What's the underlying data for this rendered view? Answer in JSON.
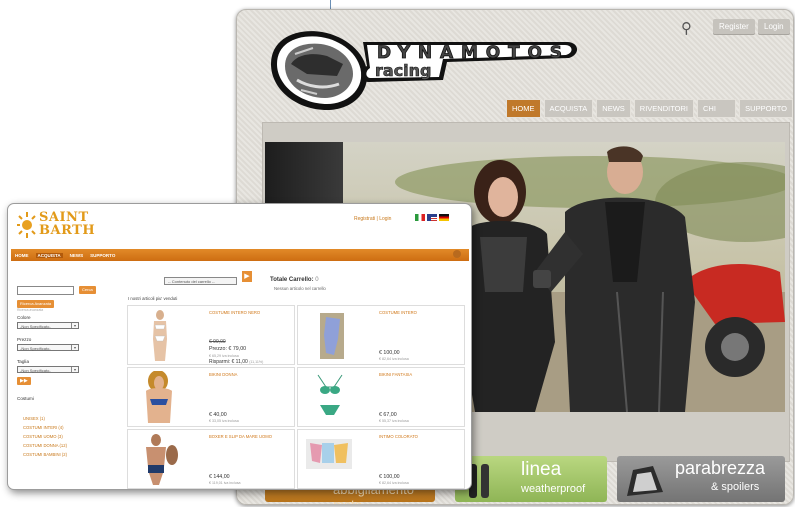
{
  "dynamotos": {
    "logo_top": "DYNAMOTOS",
    "logo_bottom": "racing",
    "buttons": {
      "register": "Register",
      "login": "Login"
    },
    "nav": [
      "HOME",
      "ACQUISTA",
      "NEWS",
      "RIVENDITORI",
      "CHI SIAMO",
      "SUPPORTO"
    ],
    "banners": {
      "left": "abbigliamento moto",
      "middle_title": "linea",
      "middle_sub": "weatherproof",
      "right_title": "parabrezza",
      "right_sub": "& spoilers"
    },
    "colors": {
      "accent": "#c0792b",
      "nav_inactive": "#c9c6c0"
    }
  },
  "saintbarth": {
    "logo_line1": "SAINT",
    "logo_line2": "BARTH",
    "top_links": {
      "register": "Registrati",
      "separator": "|",
      "login": "Login"
    },
    "nav": [
      "HOME",
      "ACQUISTA",
      "NEWS",
      "SUPPORTO"
    ],
    "search": {
      "button": "Cerca",
      "advanced": "Ricerca Avanzata",
      "advanced_sub": "Ricerca avanzata"
    },
    "filters": [
      {
        "label": "Colore",
        "value": "-Non Specificato-"
      },
      {
        "label": "Prezzo",
        "value": "-Non Specificato-"
      },
      {
        "label": "Taglia",
        "value": "-Non Specificato-"
      }
    ],
    "go": "▶▶",
    "categories_title": "Costumi",
    "categories": [
      "UNISEX (1)",
      "COSTUMI INTERI (4)",
      "COSTUMI UOMO (3)",
      "COSTUMI DONNA (12)",
      "COSTUMI BAMBINI (2)"
    ],
    "cart": {
      "select": "-- Contenuto del carrello --",
      "title": "Totale Carrello:",
      "count": "0",
      "message": "Nessun articolo nel carrello",
      "go": "▶"
    },
    "grid_title": "I nostri articoli piu' venduti",
    "products": [
      {
        "name": "COSTUME INTERO NERO",
        "old": "€ 99,00",
        "price": "Prezzo: € 79,00",
        "vat": "€ 65,29 iva inclusa",
        "saving": "Risparmi: € 11,00",
        "saving_pct": "(11,11%)"
      },
      {
        "name": "COSTUME INTERO",
        "old": "",
        "price": "€ 100,00",
        "vat": "€ 82,64 iva inclusa",
        "saving": "",
        "saving_pct": ""
      },
      {
        "name": "BIKINI DONNA",
        "old": "",
        "price": "€ 40,00",
        "vat": "€ 33,05 iva inclusa",
        "saving": "",
        "saving_pct": ""
      },
      {
        "name": "BIKINI FANTASIA",
        "old": "",
        "price": "€ 67,00",
        "vat": "€ 55,37 iva inclusa",
        "saving": "",
        "saving_pct": ""
      },
      {
        "name": "BOXER E SLIP DA MARE UOMO",
        "old": "",
        "price": "€ 144,00",
        "vat": "€ 119,01 iva inclusa",
        "saving": "",
        "saving_pct": ""
      },
      {
        "name": "INTIMO COLORATO",
        "old": "",
        "price": "€ 100,00",
        "vat": "€ 82,64 iva inclusa",
        "saving": "",
        "saving_pct": ""
      }
    ],
    "colors": {
      "accent": "#e28a28",
      "link": "#c8781a"
    }
  }
}
